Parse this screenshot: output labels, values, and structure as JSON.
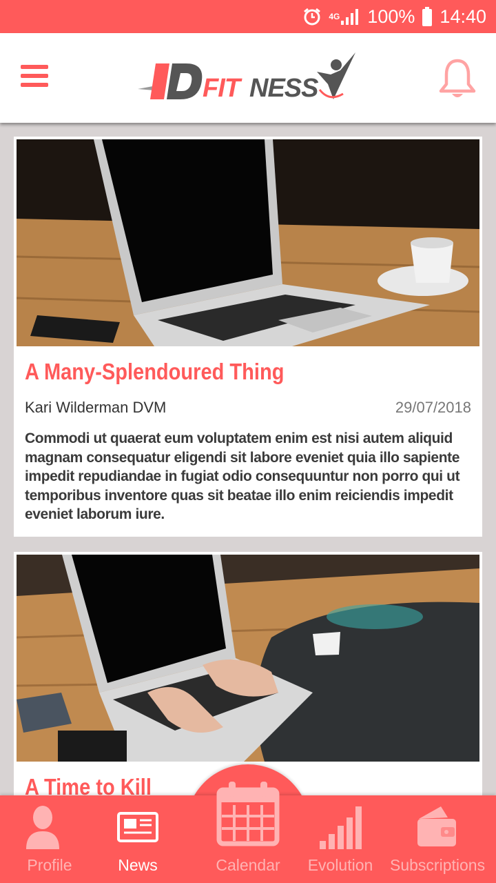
{
  "status_bar": {
    "network": "4G",
    "battery": "100%",
    "time": "14:40",
    "icons": [
      "alarm-icon",
      "signal-icon",
      "battery-icon"
    ]
  },
  "header": {
    "logo_text": "IDFITNESS",
    "menu_icon": "hamburger-menu-icon",
    "notification_icon": "bell-icon"
  },
  "articles": [
    {
      "title": "A Many-Splendoured Thing",
      "author": "Kari Wilderman DVM",
      "date": "29/07/2018",
      "excerpt": "Commodi ut quaerat eum voluptatem enim est nisi autem aliquid magnam consequatur eligendi sit labore eveniet quia illo sapiente impedit repudiandae in fugiat odio consequuntur non porro qui ut temporibus inventore quas sit beatae illo enim reiciendis impedit eveniet laborum iure."
    },
    {
      "title": "A Time to Kill"
    }
  ],
  "nav": {
    "items": [
      {
        "label": "Profile",
        "icon": "profile-icon"
      },
      {
        "label": "News",
        "icon": "news-icon",
        "active": true
      },
      {
        "label": "Calendar",
        "icon": "calendar-icon"
      },
      {
        "label": "Evolution",
        "icon": "evolution-bars-icon"
      },
      {
        "label": "Subscriptions",
        "icon": "wallet-icon"
      }
    ]
  },
  "colors": {
    "accent": "#ff5a5a",
    "inactive_nav": "#ffb3b3",
    "background": "#d8d3d3"
  }
}
